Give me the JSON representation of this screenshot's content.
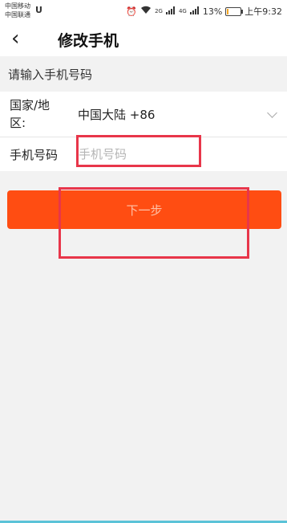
{
  "status_bar": {
    "carrier_1": "中国移动",
    "carrier_2": "中国联通",
    "notification_icon": "U",
    "network_2g": "2G",
    "network_4g": "4G",
    "battery_percent": "13%",
    "time": "上午9:32",
    "battery_level": 0.13
  },
  "header": {
    "back_icon": "‹",
    "title": "修改手机"
  },
  "section": {
    "title": "请输入手机号码"
  },
  "form": {
    "country_label": "国家/地区:",
    "country_value": "中国大陆 +86",
    "phone_label": "手机号码",
    "phone_placeholder": "手机号码",
    "phone_value": ""
  },
  "actions": {
    "next_label": "下一步"
  },
  "colors": {
    "primary": "#ff4d12",
    "highlight": "#e8364a"
  }
}
